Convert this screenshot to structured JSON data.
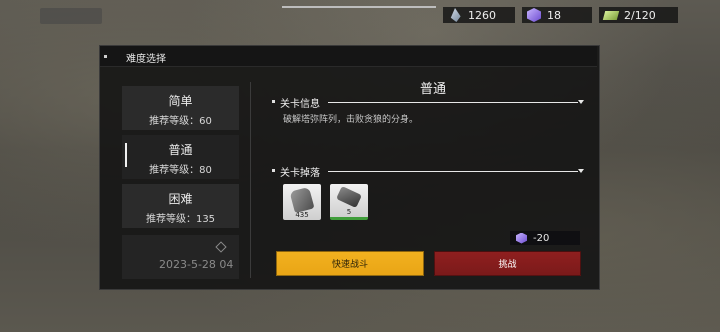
{
  "resources": {
    "energy": {
      "value": "1260",
      "icon": "energy-icon"
    },
    "cube": {
      "value": "18",
      "icon": "purple-cube-icon"
    },
    "ticket": {
      "value": "2/120",
      "icon": "ticket-icon"
    }
  },
  "panel": {
    "title": "难度选择",
    "difficulties": [
      {
        "name": "简单",
        "recommend": "推荐等级：60"
      },
      {
        "name": "普通",
        "recommend": "推荐等级：80"
      },
      {
        "name": "困难",
        "recommend": "推荐等级：135"
      }
    ],
    "selected_index": 1,
    "date_text": "2023-5-28 04",
    "stage_title": "普通",
    "info_label": "关卡信息",
    "description": "破解塔弥阵列，击败贪狼的分身。",
    "drop_label": "关卡掉落",
    "drops": [
      {
        "count": "435",
        "icon": "dog-tag-icon"
      },
      {
        "count": "5",
        "icon": "chip-icon"
      }
    ],
    "cost": {
      "value": "-20",
      "icon": "purple-cube-icon"
    },
    "quick_battle_label": "快速战斗",
    "challenge_label": "挑战"
  },
  "colors": {
    "quick_battle": "#f0ad1c",
    "challenge": "#871d1d",
    "panel_bg": "#121212",
    "item_rarity_green": "#3f9d3a"
  }
}
